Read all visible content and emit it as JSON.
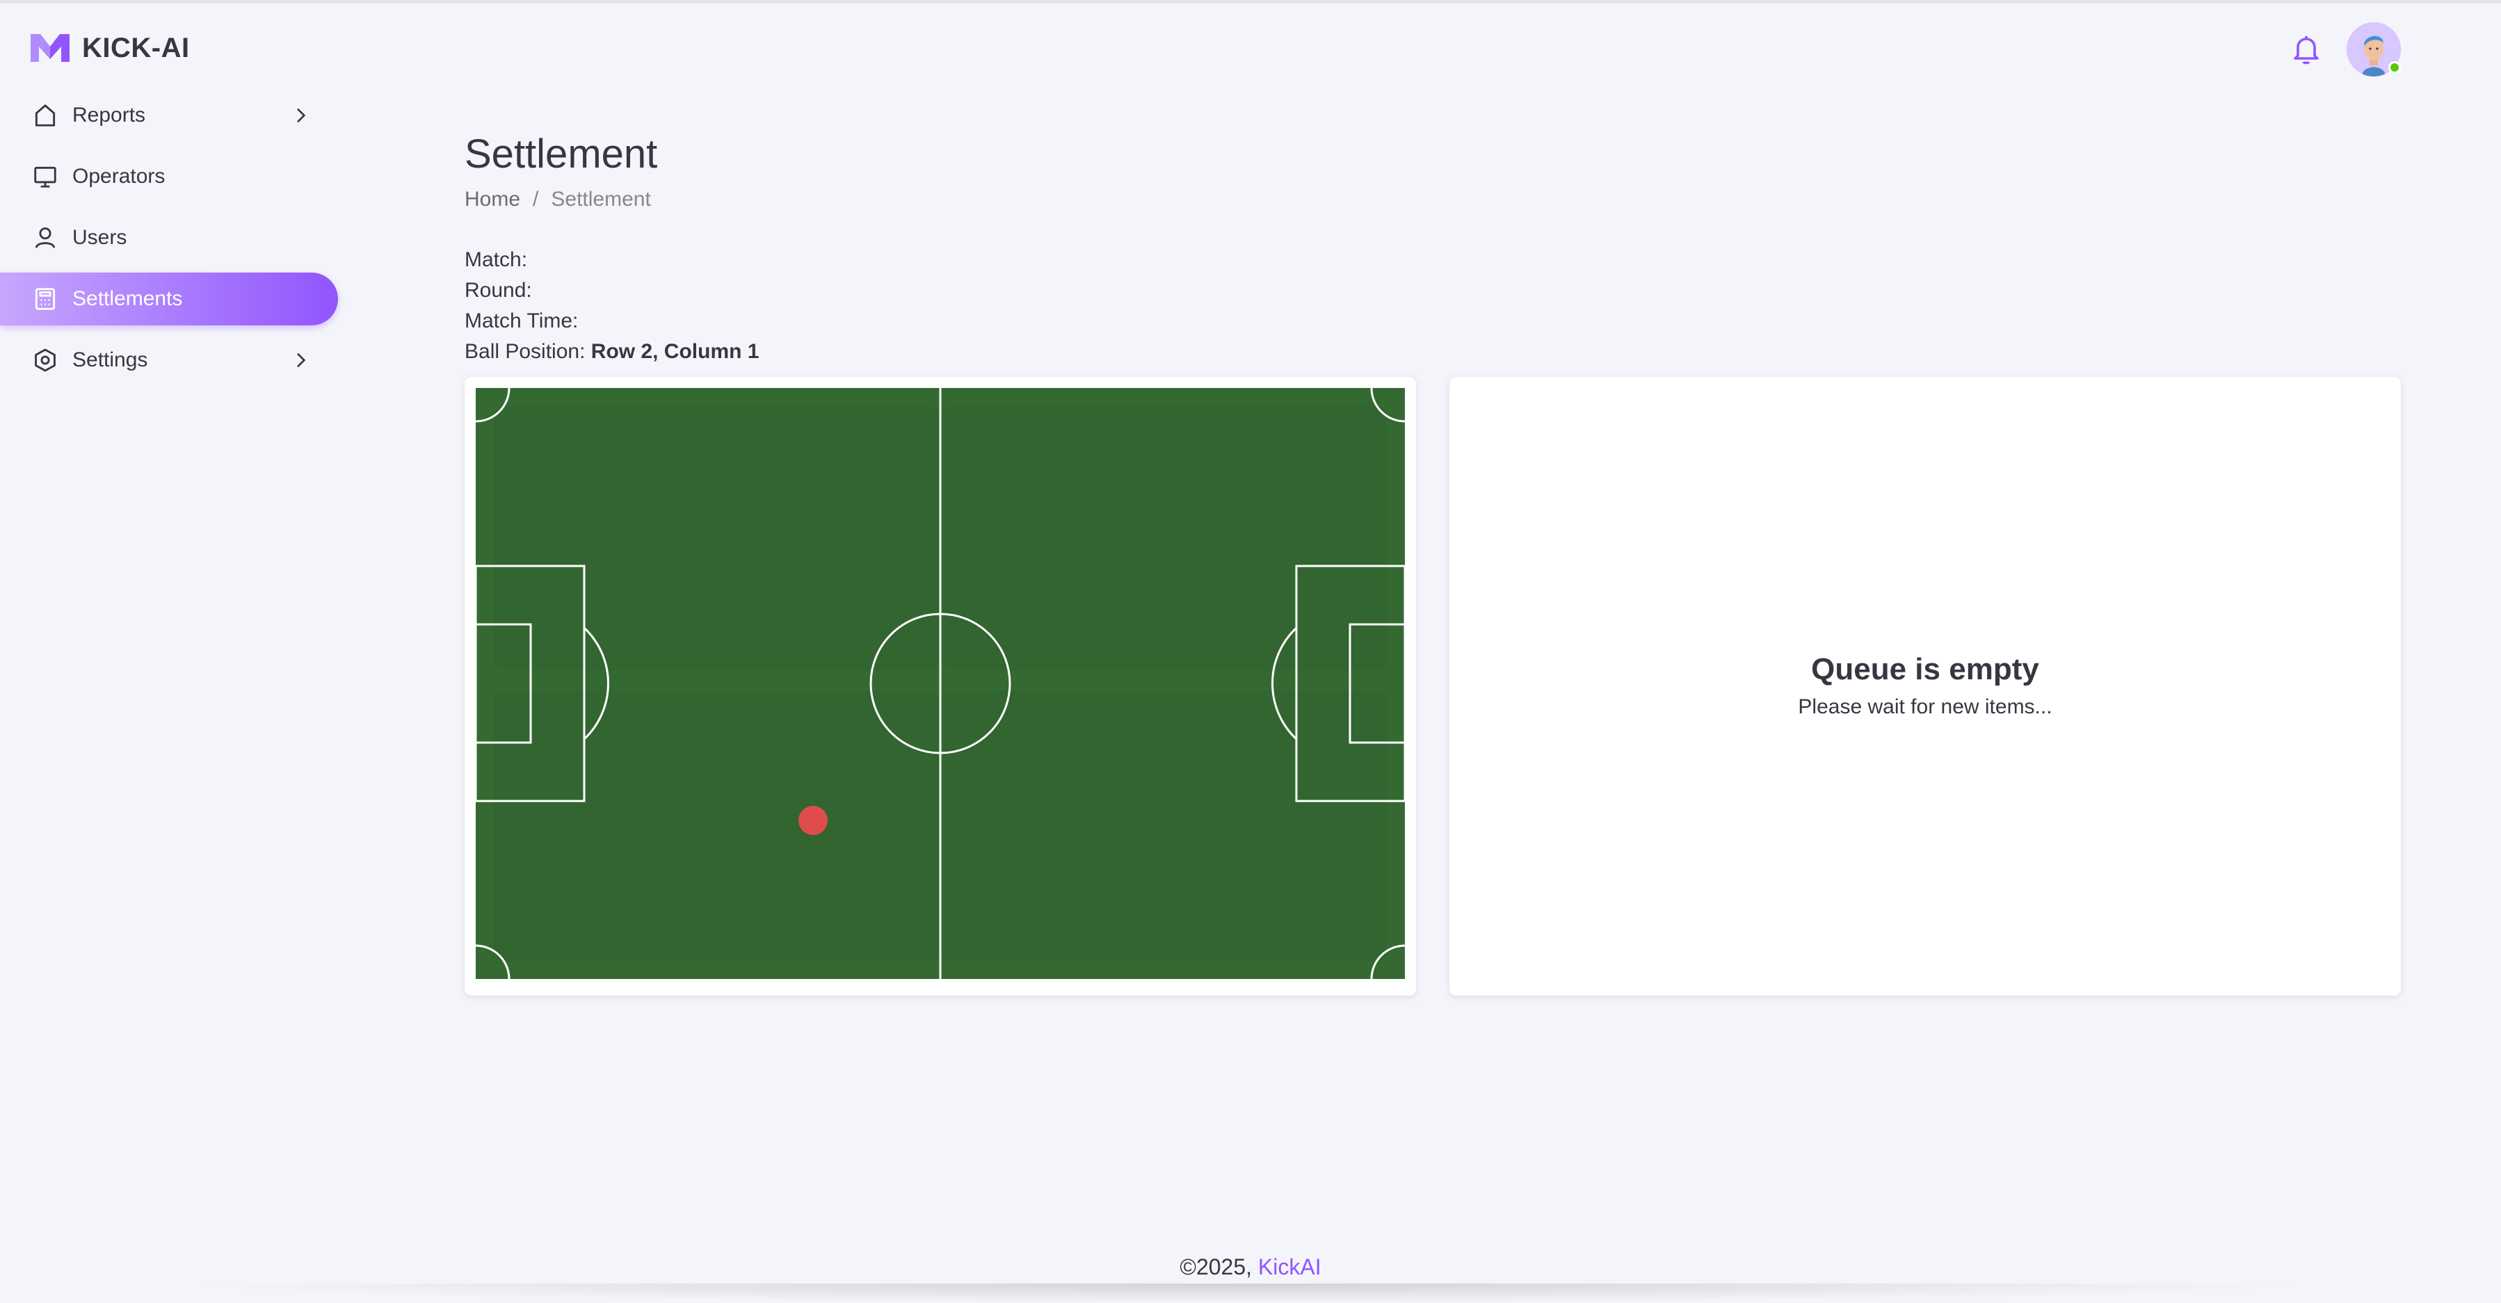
{
  "app": {
    "name": "KICK-AI",
    "accent_color": "#9155fd",
    "logo_icon": "m-logo-icon"
  },
  "sidebar": {
    "items": [
      {
        "label": "Reports",
        "icon": "home-icon",
        "has_submenu": true,
        "active": false
      },
      {
        "label": "Operators",
        "icon": "monitor-icon",
        "has_submenu": false,
        "active": false
      },
      {
        "label": "Users",
        "icon": "user-icon",
        "has_submenu": false,
        "active": false
      },
      {
        "label": "Settlements",
        "icon": "calculator-icon",
        "has_submenu": false,
        "active": true
      },
      {
        "label": "Settings",
        "icon": "hexagon-cog-icon",
        "has_submenu": true,
        "active": false
      }
    ]
  },
  "header": {
    "notifications_icon": "bell-icon",
    "avatar_status": "online",
    "status_color": "#56ca00"
  },
  "page": {
    "title": "Settlement",
    "breadcrumb": [
      "Home",
      "Settlement"
    ],
    "breadcrumb_separator": "/"
  },
  "match_info": {
    "match_label": "Match:",
    "match_value": "",
    "round_label": "Round:",
    "round_value": "",
    "match_time_label": "Match Time:",
    "match_time_value": "",
    "ball_position_label": "Ball Position:",
    "ball_position_value": "Row 2, Column 1"
  },
  "pitch": {
    "grass_color": "#346a31",
    "ball_color": "#e04c4c",
    "grid_rows": 2,
    "grid_cols": 2,
    "ball_row": 2,
    "ball_col": 1
  },
  "queue": {
    "title": "Queue is empty",
    "subtitle": "Please wait for new items..."
  },
  "footer": {
    "copyright": "©2025,",
    "brand": "KickAI"
  }
}
